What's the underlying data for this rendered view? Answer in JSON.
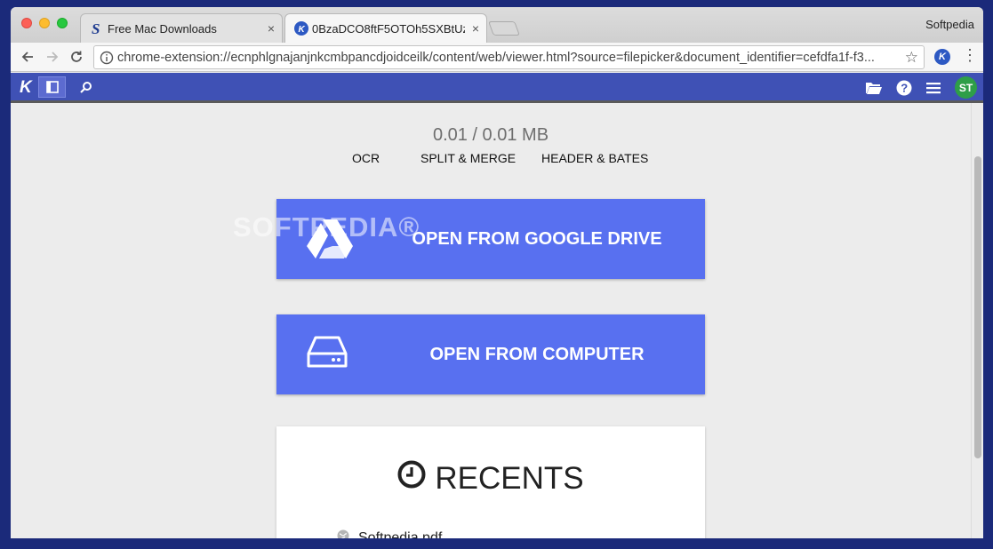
{
  "browser": {
    "tabs": [
      {
        "title": "Free Mac Downloads",
        "active": false
      },
      {
        "title": "0BzaDCO8ftF5OTOh5SXBtUz\\",
        "active": true
      }
    ],
    "profile_name": "Softpedia",
    "url": "chrome-extension://ecnphlgnajanjnkcmbpancdjoidceilk/content/web/viewer.html?source=filepicker&document_identifier=cefdfa1f-f3...",
    "tab_close_glyph": "×"
  },
  "appbar": {
    "logo": "K",
    "avatar_initials": "ST",
    "accent_color": "#3f51b5"
  },
  "main": {
    "size_text": "0.01 / 0.01 MB",
    "features": [
      "OCR",
      "SPLIT & MERGE",
      "HEADER & BATES"
    ],
    "watermark": "SOFTPEDIA®",
    "google_drive_button": "OPEN FROM GOOGLE DRIVE",
    "computer_button": "OPEN FROM COMPUTER",
    "button_color": "#5870f0",
    "recents_title": "RECENTS",
    "recent_files": [
      "Softpedia.pdf"
    ]
  }
}
